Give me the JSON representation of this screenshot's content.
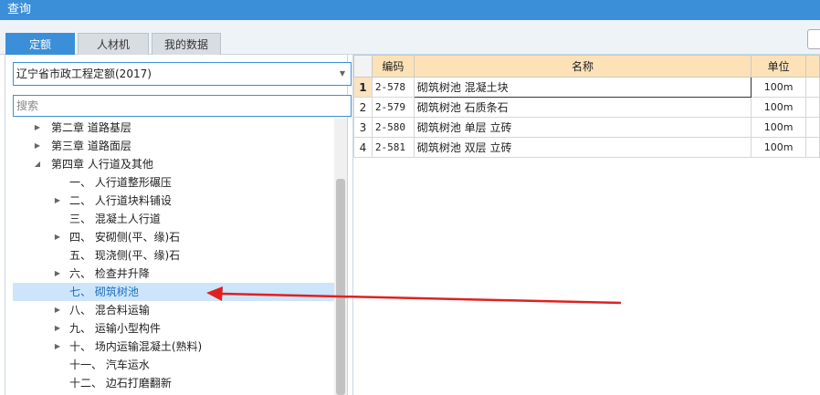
{
  "window": {
    "title": "查询"
  },
  "tabs": [
    {
      "label": "定额",
      "active": true
    },
    {
      "label": "人材机",
      "active": false
    },
    {
      "label": "我的数据",
      "active": false
    }
  ],
  "library_select": {
    "value": "辽宁省市政工程定额(2017)"
  },
  "search": {
    "placeholder": "搜索"
  },
  "tree": [
    {
      "label": "第二章 道路基层",
      "expander": "collapsed"
    },
    {
      "label": "第三章 道路面层",
      "expander": "collapsed"
    },
    {
      "label": "第四章 人行道及其他",
      "expander": "expanded"
    },
    {
      "label": "一、 人行道整形碾压",
      "expander": "none"
    },
    {
      "label": "二、 人行道块料铺设",
      "expander": "collapsed"
    },
    {
      "label": "三、 混凝土人行道",
      "expander": "none"
    },
    {
      "label": "四、 安砌侧(平、缘)石",
      "expander": "collapsed"
    },
    {
      "label": "五、 现浇侧(平、缘)石",
      "expander": "none"
    },
    {
      "label": "六、 检查井升降",
      "expander": "collapsed"
    },
    {
      "label": "七、 砌筑树池",
      "expander": "none",
      "selected": true
    },
    {
      "label": "八、 混合料运输",
      "expander": "collapsed"
    },
    {
      "label": "九、 运输小型构件",
      "expander": "collapsed"
    },
    {
      "label": "十、 场内运输混凝土(熟料)",
      "expander": "collapsed"
    },
    {
      "label": "十一、 汽车运水",
      "expander": "none"
    },
    {
      "label": "十二、 边石打磨翻新",
      "expander": "none"
    }
  ],
  "grid": {
    "columns": {
      "code": "编码",
      "name": "名称",
      "unit": "单位"
    },
    "rows": [
      {
        "num": "1",
        "code": "2-578",
        "name": "砌筑树池 混凝土块",
        "unit": "100m"
      },
      {
        "num": "2",
        "code": "2-579",
        "name": "砌筑树池 石质条石",
        "unit": "100m"
      },
      {
        "num": "3",
        "code": "2-580",
        "name": "砌筑树池 单层 立砖",
        "unit": "100m"
      },
      {
        "num": "4",
        "code": "2-581",
        "name": "砌筑树池 双层 立砖",
        "unit": "100m"
      }
    ]
  },
  "colors": {
    "accent": "#3b8fd9",
    "header": "#fde2b8",
    "selection": "#cce5fb",
    "arrow": "#e02020"
  }
}
